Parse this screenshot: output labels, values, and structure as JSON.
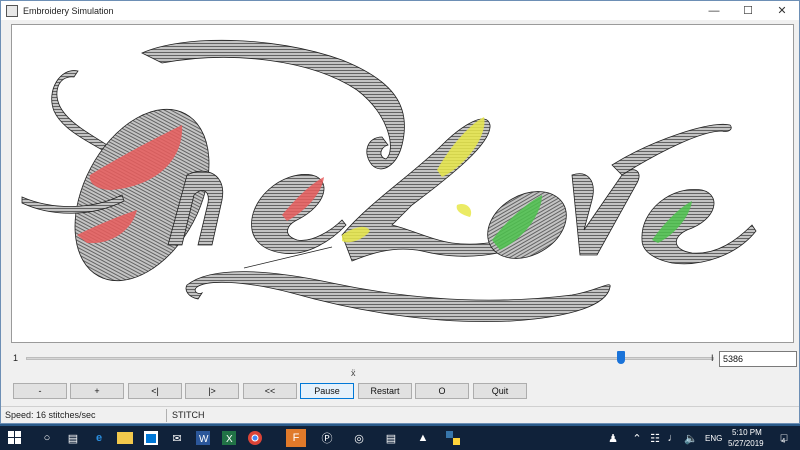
{
  "window": {
    "title": "Embroidery Simulation"
  },
  "design": {
    "text": "One Love"
  },
  "slider": {
    "min_label": "1",
    "max_label": "I",
    "value": "5386",
    "marker": "ẍ",
    "position_fraction": 0.88
  },
  "buttons": [
    "-",
    "+",
    "<|",
    "|>",
    "<<",
    "Pause",
    "Restart",
    "O",
    "Quit"
  ],
  "active_button": "Pause",
  "status": {
    "speed": "Speed: 16 stitches/sec",
    "mode": "STITCH"
  },
  "colors": {
    "fill_gray": "#b4b4b4",
    "red": "#e85c5c",
    "yellow": "#e8e84a",
    "green": "#4cc24c",
    "accent": "#0078d7"
  },
  "taskbar": {
    "lang": "ENG",
    "time": "5:10 PM",
    "date": "5/27/2019",
    "notifications": "4",
    "icons": [
      "windows-start-icon",
      "search-icon",
      "task-view-icon",
      "edge-icon",
      "file-explorer-icon",
      "store-icon",
      "mail-icon",
      "word-icon",
      "excel-icon",
      "chrome-icon",
      "app-f-icon",
      "app-p-icon",
      "app-target-icon",
      "app-clapper-icon",
      "app-tent-icon",
      "app-python-icon"
    ]
  }
}
